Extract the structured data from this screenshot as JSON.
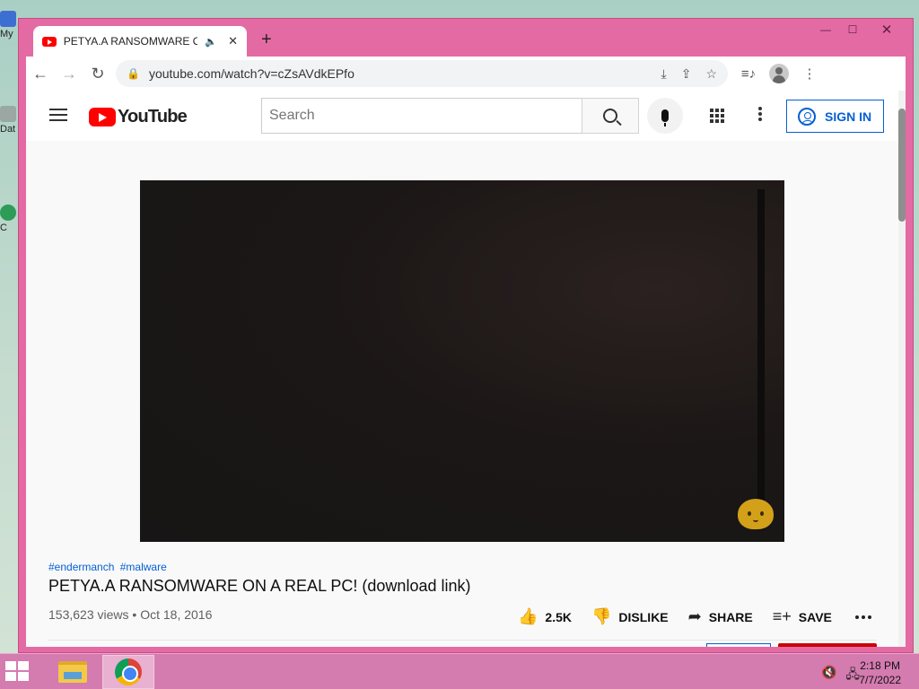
{
  "desktop": {
    "icons": [
      {
        "label": "My",
        "icon": "computer-icon"
      },
      {
        "label": "Dat",
        "icon": "folder-icon"
      },
      {
        "label": "C",
        "icon": "app-icon"
      }
    ]
  },
  "window": {
    "controls": {
      "minimize": "—",
      "maximize": "☐",
      "close": "✕"
    }
  },
  "tab": {
    "title": "PETYA.A RANSOMWARE ON A REAL PC! (download link) - YouTube",
    "speaker": "🔈",
    "close": "✕",
    "new_tab": "+"
  },
  "toolbar": {
    "back": "←",
    "forward": "→",
    "reload": "↻",
    "lock": "🔒",
    "url": "youtube.com/watch?v=cZsAVdkEPfo",
    "icons": [
      "install-icon",
      "share-icon",
      "bookmark-star-icon",
      "media-control-icon",
      "profile-icon",
      "menu-icon"
    ],
    "install": "⤓",
    "share": "⇪",
    "star": "☆",
    "media": "≡♪",
    "menu": "⋮"
  },
  "youtube": {
    "logo_text": "YouTube",
    "search_placeholder": "Search",
    "sign_in": "SIGN IN",
    "brand_color": "#ff0000",
    "accent_color": "#065fd4"
  },
  "video": {
    "hashtags": [
      "#endermanch",
      "#malware"
    ],
    "title": "PETYA.A RANSOMWARE ON A REAL PC! (download link)",
    "views": "153,623 views",
    "separator": "•",
    "date": "Oct 18, 2016",
    "actions": {
      "like_count": "2.5K",
      "dislike": "DISLIKE",
      "share": "SHARE",
      "save": "SAVE"
    },
    "action_icons": {
      "like": "👍",
      "dislike": "👎",
      "share": "➦",
      "save": "≡+"
    }
  },
  "taskbar": {
    "apps": [
      "file-explorer-icon",
      "chrome-icon"
    ],
    "tray": {
      "volume": "🔇",
      "network": "🖧"
    },
    "time": "2:18 PM",
    "date": "7/7/2022"
  }
}
